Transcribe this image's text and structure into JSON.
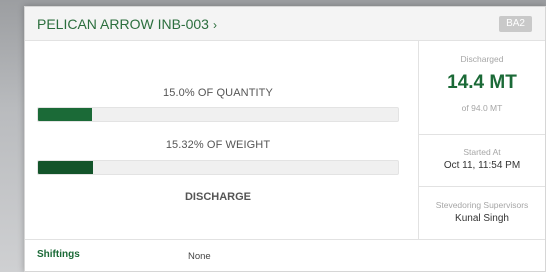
{
  "header": {
    "vessel_name": "PELICAN ARROW INB-003",
    "chevron": "›",
    "badge": "BA2"
  },
  "progress": {
    "quantity_label": "15.0% OF QUANTITY",
    "quantity_fraction": 0.15,
    "weight_label": "15.32% OF WEIGHT",
    "weight_fraction": 0.1532,
    "stage": "DISCHARGE"
  },
  "summary": {
    "discharged_label": "Discharged",
    "discharged_value": "14.4 MT",
    "total_label": "of 94.0 MT",
    "started_label": "Started At",
    "started_value": "Oct 11, 11:54 PM",
    "supervisor_label": "Stevedoring Supervisors",
    "supervisor_value": "Kunal Singh"
  },
  "footer": {
    "shiftings_label": "Shiftings",
    "shiftings_value": "None"
  },
  "colors": {
    "accent": "#1b6a37",
    "badge": "#c9c9c9"
  }
}
